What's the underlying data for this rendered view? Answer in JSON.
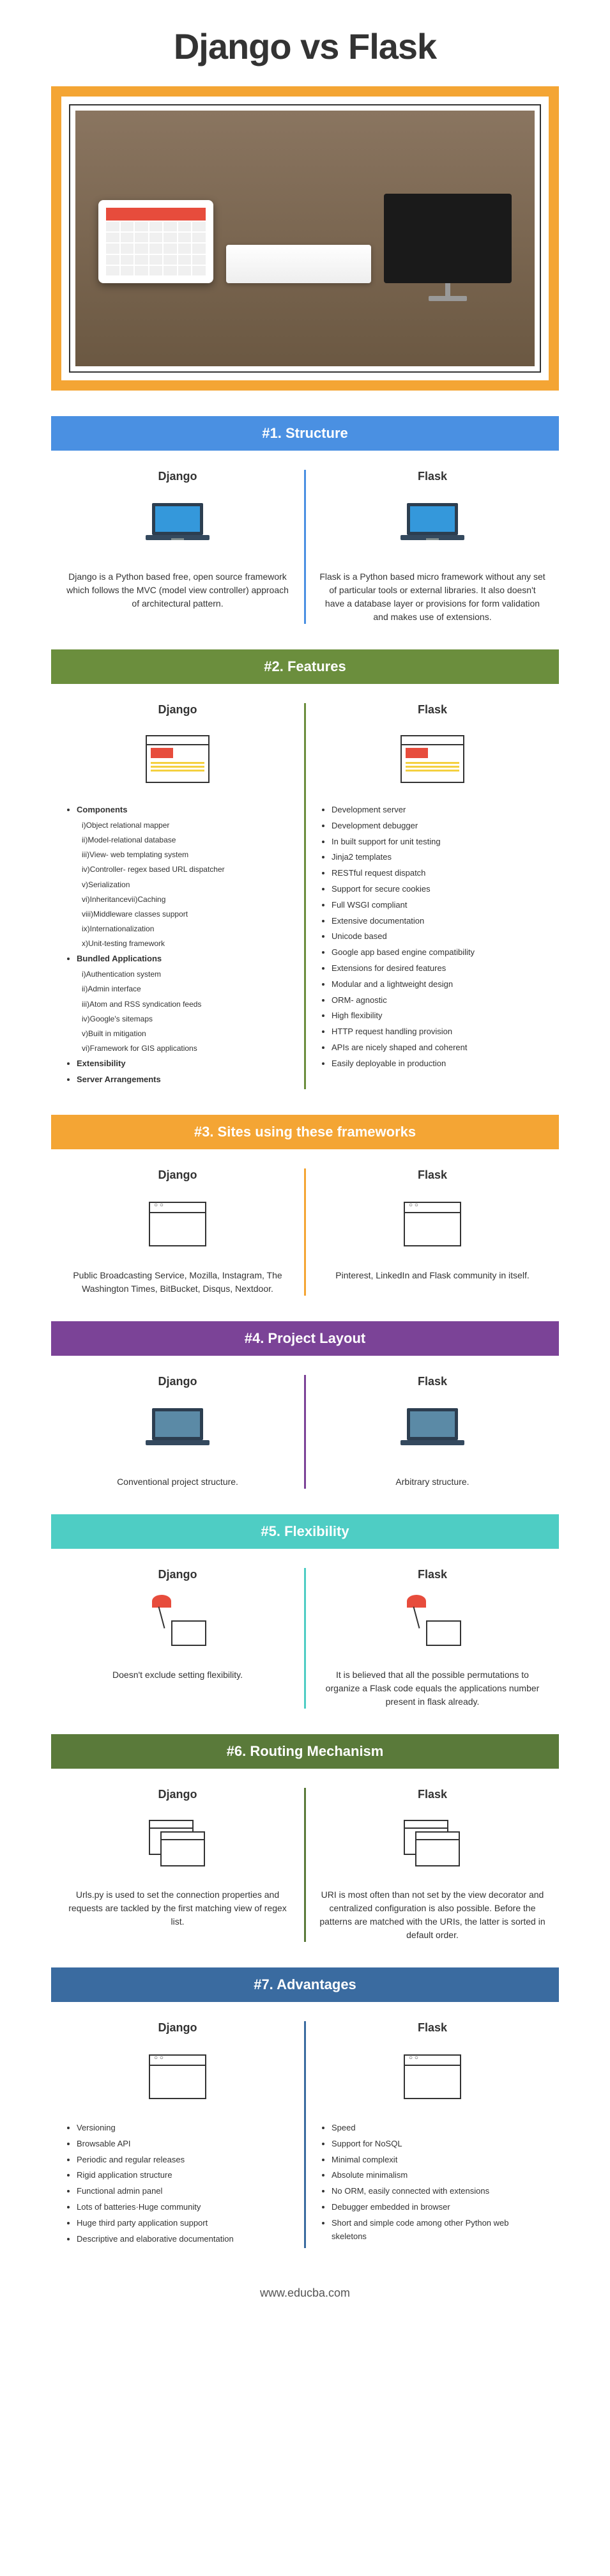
{
  "title": "Django vs Flask",
  "footer": "www.educba.com",
  "sections": [
    {
      "header": "#1. Structure",
      "color": "blue",
      "left_title": "Django",
      "right_title": "Flask",
      "left_text": "Django is a Python based free, open source framework which follows the MVC (model view controller) approach of architectural pattern.",
      "right_text": "Flask is a Python based micro framework without any set of particular tools or external libraries. It also doesn't have a database layer or provisions for form validation and makes use of extensions."
    },
    {
      "header": "#2. Features",
      "color": "green",
      "left_title": "Django",
      "right_title": "Flask"
    },
    {
      "header": "#3. Sites using these frameworks",
      "color": "orange",
      "left_title": "Django",
      "right_title": "Flask",
      "left_text": "Public Broadcasting Service, Mozilla, Instagram, The Washington Times, BitBucket, Disqus, Nextdoor.",
      "right_text": "Pinterest, LinkedIn and Flask community in itself."
    },
    {
      "header": "#4. Project Layout",
      "color": "purple",
      "left_title": "Django",
      "right_title": "Flask",
      "left_text": "Conventional project structure.",
      "right_text": "Arbitrary structure."
    },
    {
      "header": "#5. Flexibility",
      "color": "teal",
      "left_title": "Django",
      "right_title": "Flask",
      "left_text": "Doesn't exclude setting flexibility.",
      "right_text": "It is believed that all the possible permutations to organize a Flask code equals the applications number present in flask already."
    },
    {
      "header": "#6. Routing Mechanism",
      "color": "darkgreen",
      "left_title": "Django",
      "right_title": "Flask",
      "left_text": "Urls.py is used to set the connection properties and requests are tackled by the first matching view of regex list.",
      "right_text": "URI is most often than not set by the view decorator and centralized configuration is also possible. Before the patterns are matched with the URIs, the latter is sorted in default order."
    },
    {
      "header": "#7. Advantages",
      "color": "darkblue",
      "left_title": "Django",
      "right_title": "Flask"
    }
  ],
  "features_django": {
    "components_label": "Components",
    "components": [
      "i)Object relational mapper",
      "ii)Model-relational database",
      "iii)View- web templating system",
      "iv)Controller- regex based URL dispatcher",
      "v)Serialization",
      "vi)Inheritancevii)Caching",
      "viii)Middleware classes support",
      "ix)Internationalization",
      "x)Unit-testing framework"
    ],
    "bundled_label": "Bundled Applications",
    "bundled": [
      "i)Authentication system",
      "ii)Admin interface",
      "iii)Atom and RSS syndication feeds",
      "iv)Google's sitemaps",
      "v)Built in mitigation",
      "vi)Framework for GIS applications"
    ],
    "extensibility": "Extensibility",
    "server": "Server Arrangements"
  },
  "features_flask": [
    "Development server",
    "Development debugger",
    "In built support for unit testing",
    "Jinja2 templates",
    "RESTful request dispatch",
    "Support for secure cookies",
    "Full WSGI compliant",
    "Extensive documentation",
    "Unicode based",
    "Google app based engine compatibility",
    "Extensions for desired features",
    "Modular and a lightweight design",
    "ORM- agnostic",
    "High flexibility",
    "HTTP request handling provision",
    "APIs are nicely shaped and coherent",
    "Easily deployable in production"
  ],
  "advantages_django": [
    "Versioning",
    "Browsable API",
    "Periodic and regular releases",
    "Rigid application structure",
    "Functional admin panel",
    "Lots of batteries·Huge community",
    "Huge third party application support",
    "Descriptive and elaborative documentation"
  ],
  "advantages_flask": [
    "Speed",
    "Support for NoSQL",
    "Minimal complexit",
    "Absolute minimalism",
    "No ORM, easily connected with extensions",
    "Debugger embedded in browser",
    "Short and simple code among other Python web skeletons"
  ]
}
